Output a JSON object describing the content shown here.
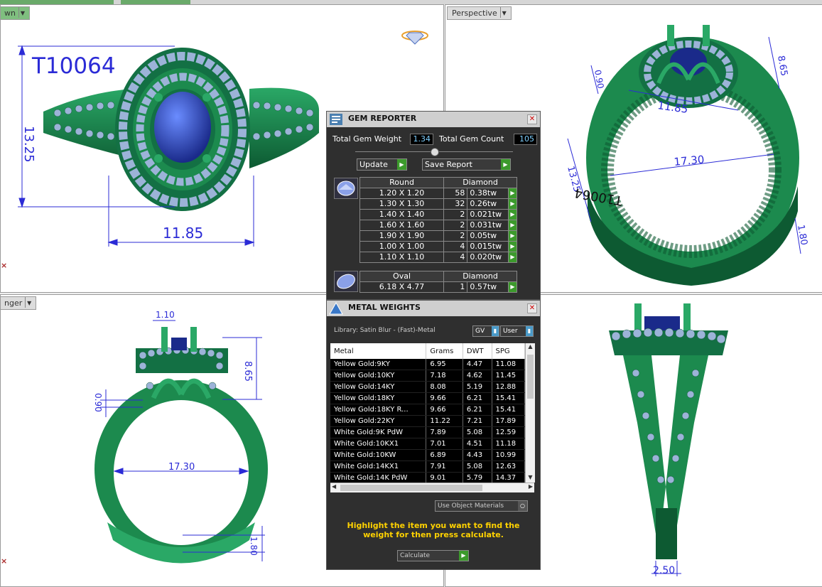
{
  "tabs": {
    "top_left": "wn",
    "top_right": "Perspective",
    "bottom_left": "nger"
  },
  "model_label": "T10064",
  "dimensions": {
    "top_left": {
      "height": "13.25",
      "width": "11.85"
    },
    "top_right": {
      "a": "8.65",
      "b": "0.90",
      "c": "11.85",
      "d": "17.30",
      "e": "13.25",
      "f": "1.80",
      "engraving": "T10064"
    },
    "bottom_left": {
      "a": "1.10",
      "b": "8.65",
      "c": "0.90",
      "d": "17.30",
      "e": "1.80"
    },
    "bottom_right": {
      "a": "2.50"
    }
  },
  "gem_reporter": {
    "title": "GEM REPORTER",
    "total_weight_label": "Total Gem Weight",
    "total_weight": "1.34",
    "total_count_label": "Total Gem Count",
    "total_count": "105",
    "update_label": "Update",
    "save_label": "Save Report",
    "round": {
      "shape": "Round",
      "material": "Diamond",
      "rows": [
        {
          "size": "1.20 X 1.20",
          "count": "58",
          "weight": "0.38tw"
        },
        {
          "size": "1.30 X 1.30",
          "count": "32",
          "weight": "0.26tw"
        },
        {
          "size": "1.40 X 1.40",
          "count": "2",
          "weight": "0.021tw"
        },
        {
          "size": "1.60 X 1.60",
          "count": "2",
          "weight": "0.031tw"
        },
        {
          "size": "1.90 X 1.90",
          "count": "2",
          "weight": "0.05tw"
        },
        {
          "size": "1.00 X 1.00",
          "count": "4",
          "weight": "0.015tw"
        },
        {
          "size": "1.10 X 1.10",
          "count": "4",
          "weight": "0.020tw"
        }
      ]
    },
    "oval": {
      "shape": "Oval",
      "material": "Diamond",
      "rows": [
        {
          "size": "6.18 X 4.77",
          "count": "1",
          "weight": "0.57tw"
        }
      ]
    }
  },
  "metal_weights": {
    "title": "METAL WEIGHTS",
    "library": "Library: Satin Blur - (Fast)-Metal",
    "gv": "GV",
    "user": "User",
    "columns": [
      "Metal",
      "Grams",
      "DWT",
      "SPG"
    ],
    "rows": [
      [
        "Yellow Gold:9KY",
        "6.95",
        "4.47",
        "11.08"
      ],
      [
        "Yellow Gold:10KY",
        "7.18",
        "4.62",
        "11.45"
      ],
      [
        "Yellow Gold:14KY",
        "8.08",
        "5.19",
        "12.88"
      ],
      [
        "Yellow Gold:18KY",
        "9.66",
        "6.21",
        "15.41"
      ],
      [
        "Yellow Gold:18KY R...",
        "9.66",
        "6.21",
        "15.41"
      ],
      [
        "Yellow Gold:22KY",
        "11.22",
        "7.21",
        "17.89"
      ],
      [
        "White Gold:9K PdW",
        "7.89",
        "5.08",
        "12.59"
      ],
      [
        "White Gold:10KX1",
        "7.01",
        "4.51",
        "11.18"
      ],
      [
        "White Gold:10KW",
        "6.89",
        "4.43",
        "10.99"
      ],
      [
        "White Gold:14KX1",
        "7.91",
        "5.08",
        "12.63"
      ],
      [
        "White Gold:14K PdW",
        "9.01",
        "5.79",
        "14.37"
      ]
    ],
    "use_object_materials": "Use Object Materials",
    "hint": "Highlight the item you want to find the weight for then press calculate.",
    "calculate_label": "Calculate"
  },
  "colors": {
    "metal": "#1c8a4e",
    "metal_dark": "#0d5a32",
    "gem": "#2f4fc0",
    "pave": "#9cb3d8",
    "dimension": "#2b2bd6",
    "panel": "#2f2f2f",
    "value_text": "#7fd0ff",
    "hint": "#ffd200"
  }
}
